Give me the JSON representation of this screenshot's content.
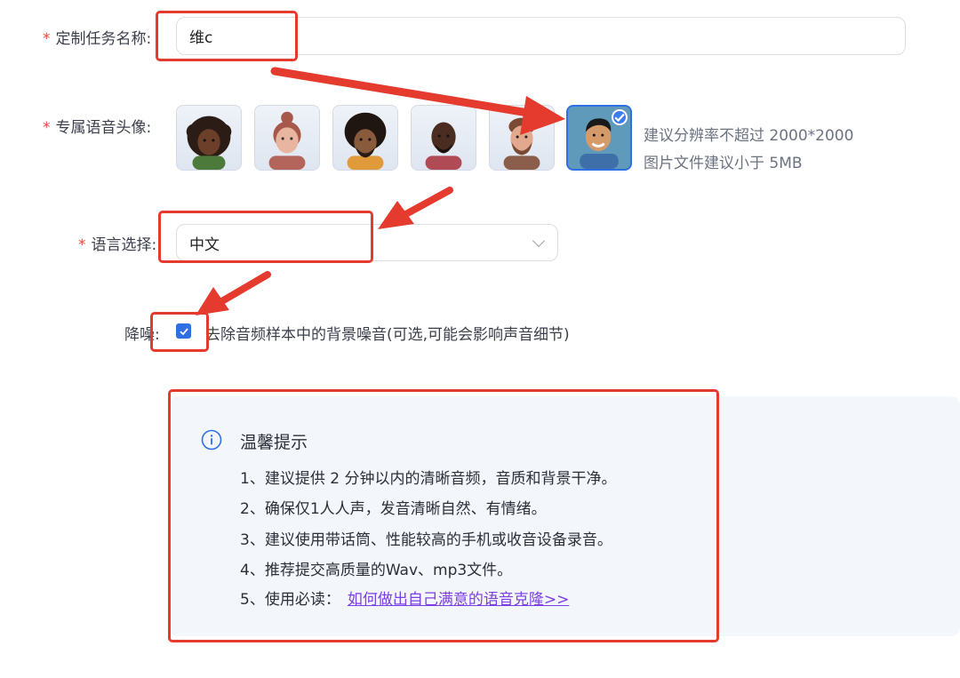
{
  "form": {
    "task_name_label": "定制任务名称:",
    "task_name_value": "维c",
    "avatar_label": "专属语音头像:",
    "avatar_hint_line1": "建议分辨率不超过 2000*2000",
    "avatar_hint_line2": "图片文件建议小于 5MB",
    "avatars": [
      {
        "name": "avatar-1",
        "selected": false
      },
      {
        "name": "avatar-2",
        "selected": false
      },
      {
        "name": "avatar-3",
        "selected": false
      },
      {
        "name": "avatar-4",
        "selected": false
      },
      {
        "name": "avatar-5",
        "selected": false
      },
      {
        "name": "avatar-6",
        "selected": true
      }
    ],
    "language_label": "语言选择:",
    "language_value": "中文",
    "denoise_label": "降噪:",
    "denoise_checked": true,
    "denoise_text": "去除音频样本中的背景噪音(可选,可能会影响声音细节)",
    "required_mark": "*"
  },
  "tips": {
    "title": "温馨提示",
    "lines": [
      "1、建议提供 2 分钟以内的清晰音频，音质和背景干净。",
      "2、确保仅1人人声，发音清晰自然、有情绪。",
      "3、建议使用带话筒、性能较高的手机或收音设备录音。",
      "4、推荐提交高质量的Wav、mp3文件。",
      "5、使用必读："
    ],
    "link_text": "如何做出自己满意的语音克隆>>"
  },
  "colors": {
    "accent": "#2f6fe4",
    "required": "#f04438",
    "annotation": "#e53b2e",
    "link": "#7b3fe4",
    "tips_background": "#f3f6fb"
  },
  "icons": {
    "info": "info-circle-icon",
    "chevron": "chevron-down-icon",
    "check": "check-icon"
  }
}
